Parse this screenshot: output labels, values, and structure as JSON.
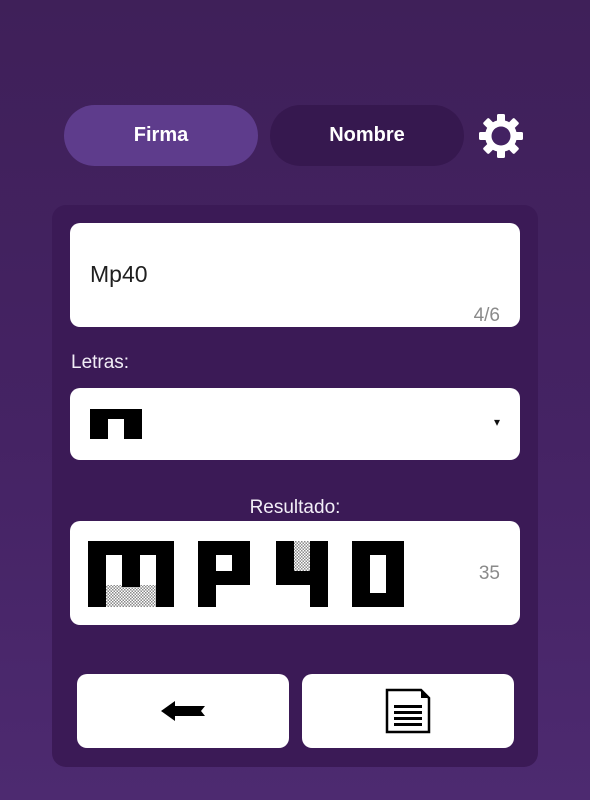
{
  "tabs": {
    "firma": "Firma",
    "nombre": "Nombre"
  },
  "text_input": {
    "value": "Mp40",
    "counter": "4/6"
  },
  "letras": {
    "label": "Letras:",
    "caret": "▾"
  },
  "resultado": {
    "label": "Resultado:",
    "count": "35"
  },
  "icons": {
    "settings": "gear-icon",
    "back": "arrow-left-icon",
    "document": "document-icon",
    "font_style": "block-letter-sample"
  },
  "colors": {
    "background": "#452364",
    "panel": "#3b1a56",
    "active_tab": "#5e3c8c",
    "inactive_tab": "#36184f"
  }
}
